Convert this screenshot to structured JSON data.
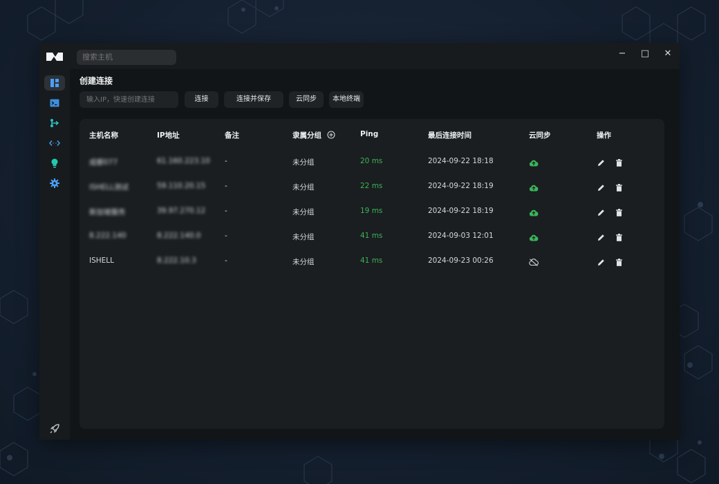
{
  "search": {
    "placeholder": "搜索主机"
  },
  "window_controls": {
    "minimize": "−",
    "maximize": "□",
    "close": "✕"
  },
  "sidebar": {
    "items": [
      {
        "icon": "dashboard-icon",
        "active": true
      },
      {
        "icon": "terminal-icon",
        "active": false
      },
      {
        "icon": "sftp-transfer-icon",
        "active": false
      },
      {
        "icon": "port-forward-icon",
        "active": false
      },
      {
        "icon": "snippet-bulb-icon",
        "active": false
      },
      {
        "icon": "gear-icon",
        "active": false
      }
    ],
    "bottom_icon": "rocket-icon"
  },
  "main": {
    "title": "创建连接",
    "ip_placeholder": "输入IP，快速创建连接",
    "buttons": {
      "connect": "连接",
      "connect_save": "连接并保存",
      "cloud_sync": "云同步",
      "local_terminal": "本地终端"
    }
  },
  "table": {
    "headers": [
      "主机名称",
      "IP地址",
      "备注",
      "隶属分组",
      "Ping",
      "最后连接时间",
      "云同步",
      "操作"
    ],
    "rows": [
      {
        "name": "成都077",
        "ip": "61.160.223.10",
        "note": "-",
        "group": "未分组",
        "ping": "20 ms",
        "time": "2024-09-22 18:18",
        "synced": true,
        "blur_name": true
      },
      {
        "name": "ISHELL测试",
        "ip": "59.110.20.15",
        "note": "-",
        "group": "未分组",
        "ping": "22 ms",
        "time": "2024-09-22 18:19",
        "synced": true,
        "blur_name": true
      },
      {
        "name": "新加坡服务",
        "ip": "39.97.270.12",
        "note": "-",
        "group": "未分组",
        "ping": "19 ms",
        "time": "2024-09-22 18:19",
        "synced": true,
        "blur_name": true
      },
      {
        "name": "8.222.140",
        "ip": "8.222.140.0",
        "note": "-",
        "group": "未分组",
        "ping": "41 ms",
        "time": "2024-09-03 12:01",
        "synced": true,
        "blur_name": true
      },
      {
        "name": "ISHELL",
        "ip": "8.222.10.3",
        "note": "-",
        "group": "未分组",
        "ping": "41 ms",
        "time": "2024-09-23 00:26",
        "synced": false,
        "blur_name": false
      }
    ]
  },
  "colors": {
    "accent": "#4a9ff5",
    "ping_green": "#3cb35a",
    "sync_green": "#3ab55c"
  }
}
